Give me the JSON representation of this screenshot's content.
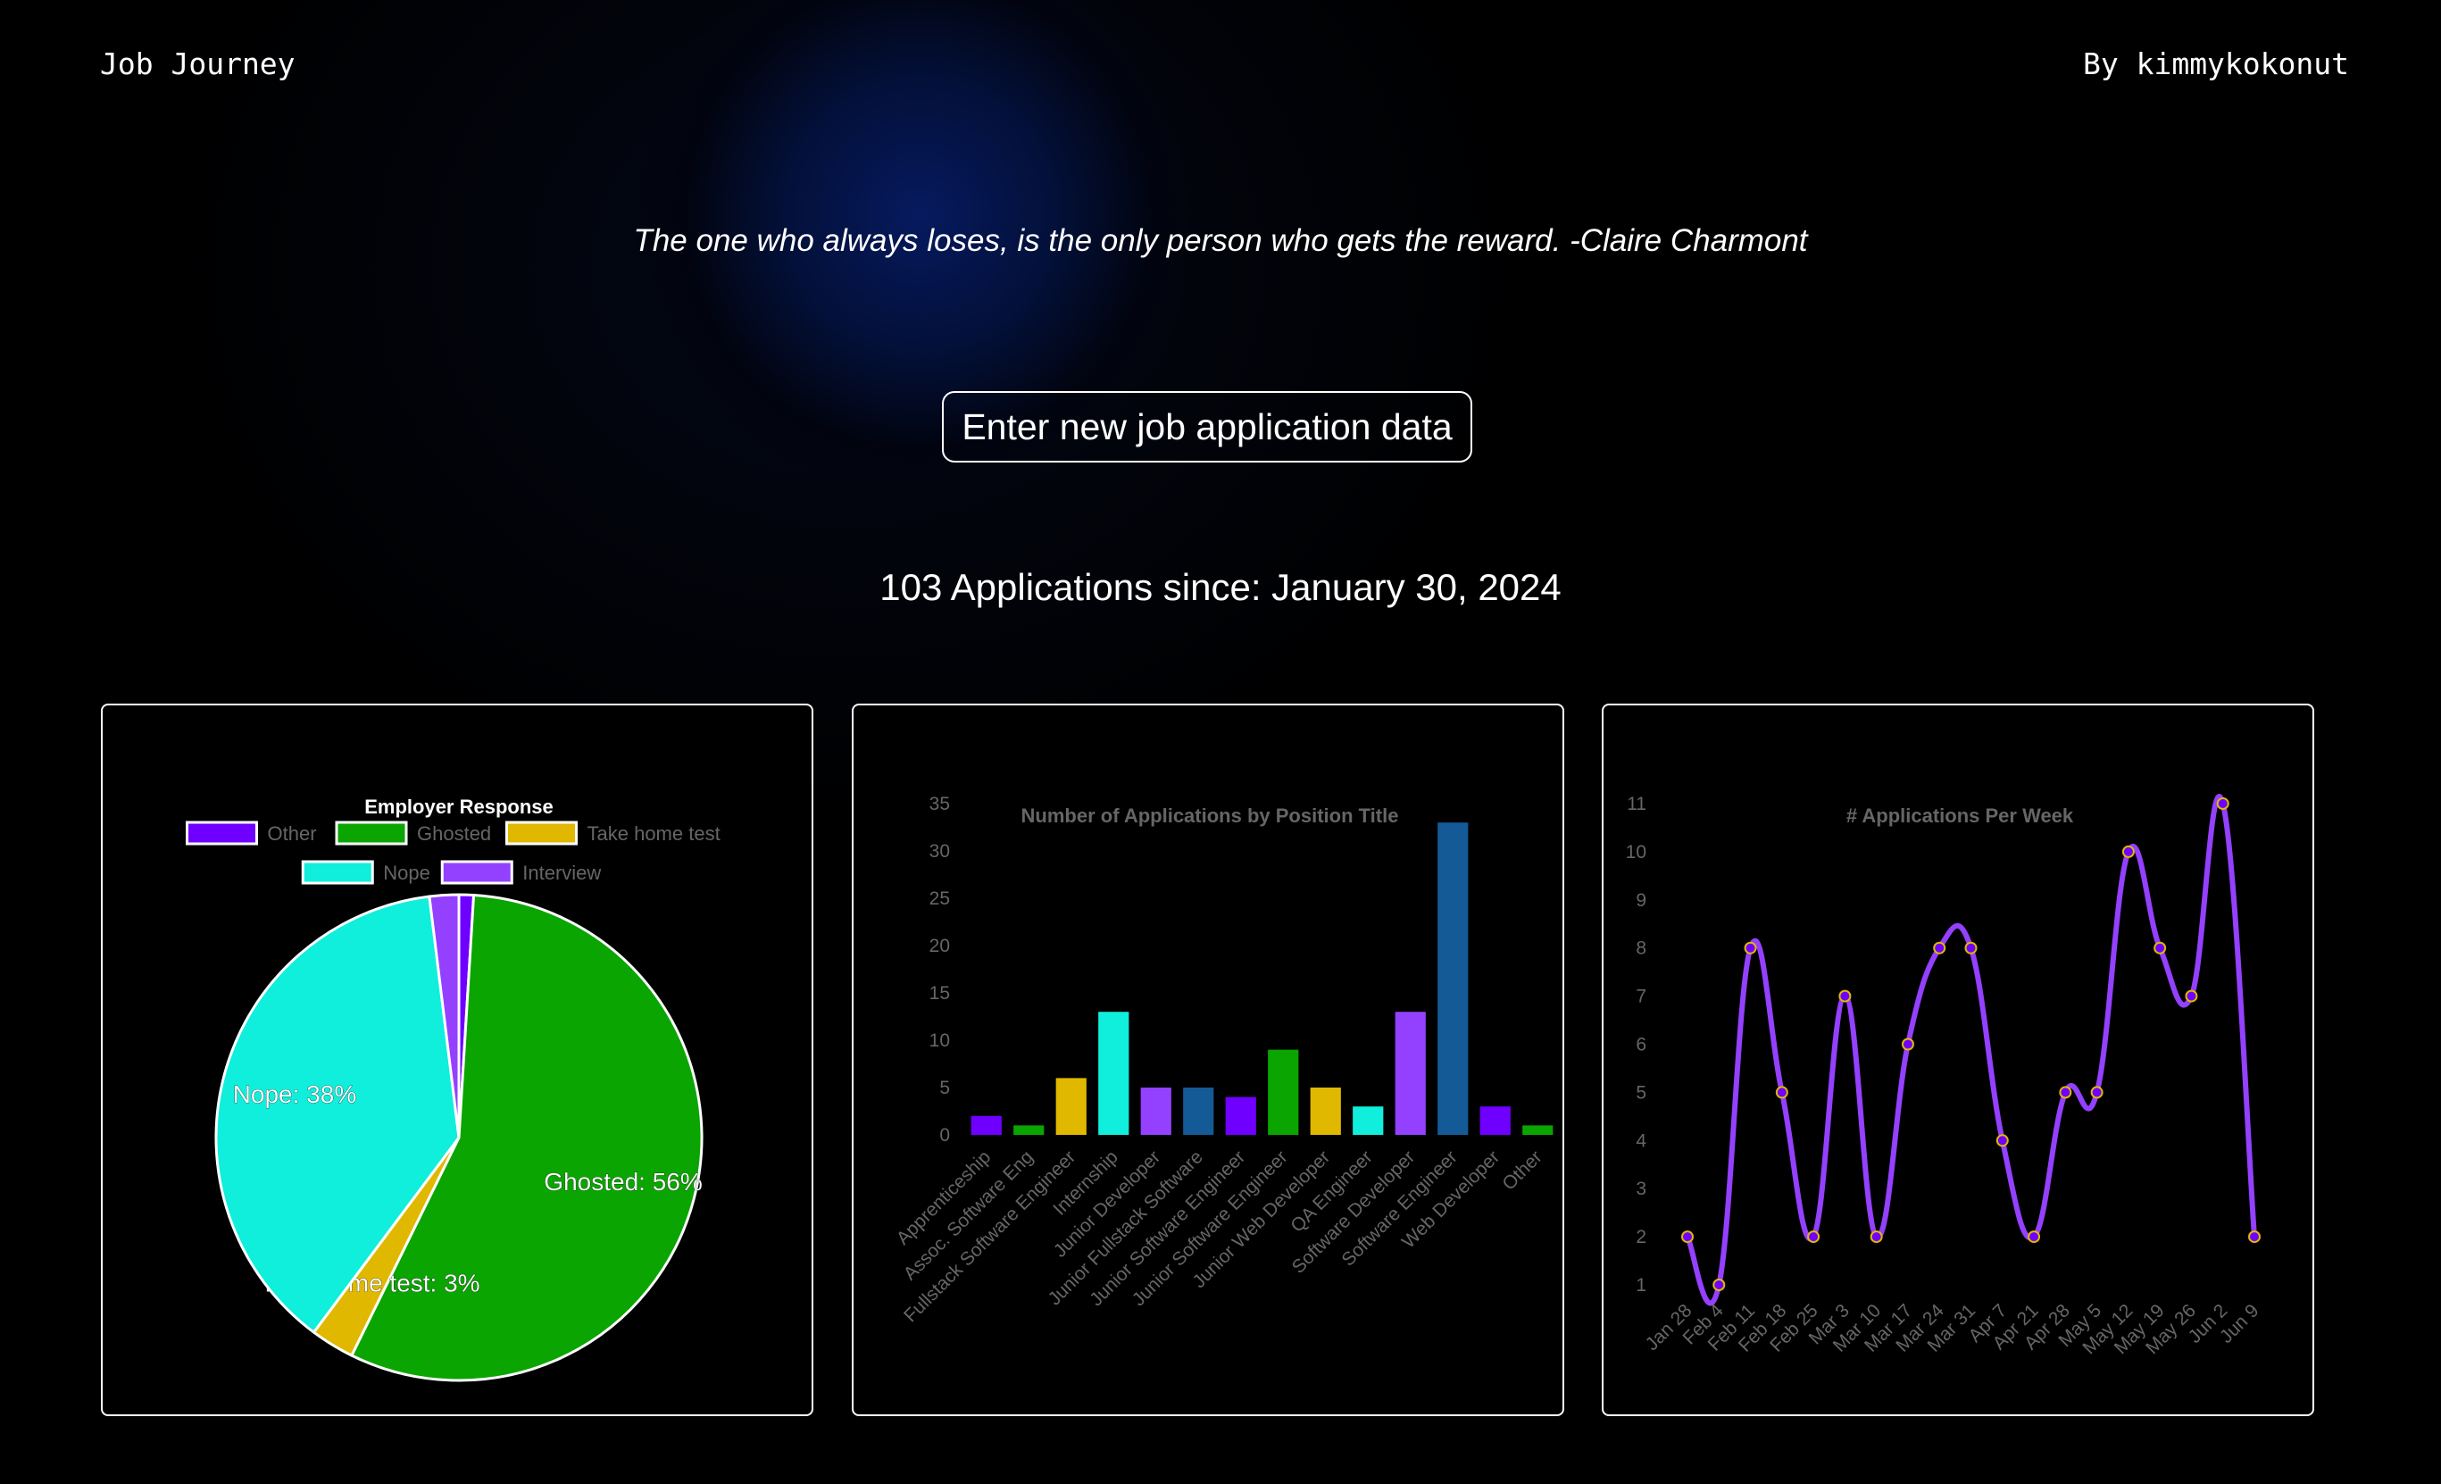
{
  "header": {
    "brand": "Job Journey",
    "author": "By kimmykokonut"
  },
  "quote": "The one who always loses, is the only person who gets the reward. -Claire Charmont",
  "cta_button": "Enter new job application data",
  "summary": "103 Applications since: January 30, 2024",
  "colors": {
    "other": "#6f00ff",
    "ghosted": "#0aa500",
    "take_home": "#e0b800",
    "nope": "#10eedc",
    "interview": "#9440ff",
    "blue": "#135a96",
    "line": "#9440ff",
    "point_border": "#e0b800"
  },
  "chart_data": [
    {
      "type": "pie",
      "title": "Employer Response",
      "legend_position": "top",
      "categories": [
        "Other",
        "Ghosted",
        "Take home test",
        "Nope",
        "Interview"
      ],
      "values": [
        1,
        58,
        3,
        39,
        2
      ],
      "colors": [
        "#6f00ff",
        "#0aa500",
        "#e0b800",
        "#10eedc",
        "#9440ff"
      ],
      "data_labels": [
        "",
        "Ghosted: 56%",
        "Take home test: 3%",
        "Nope: 38%",
        ""
      ]
    },
    {
      "type": "bar",
      "title": "Number of Applications by Position Title",
      "categories": [
        "Apprenticeship",
        "Assoc. Software Eng",
        "Fullstack Software Engineer",
        "Internship",
        "Junior Developer",
        "Junior Fullstack Software",
        "Junior Software Engineer",
        "Junior Software Engineer",
        "Junior Web Developer",
        "QA Engineer",
        "Software Developer",
        "Software Engineer",
        "Web Developer",
        "Other"
      ],
      "values": [
        2,
        1,
        6,
        13,
        5,
        5,
        4,
        9,
        5,
        3,
        13,
        33,
        3,
        1
      ],
      "colors": [
        "#6f00ff",
        "#0aa500",
        "#e0b800",
        "#10eedc",
        "#9440ff",
        "#135a96",
        "#6f00ff",
        "#0aa500",
        "#e0b800",
        "#10eedc",
        "#9440ff",
        "#135a96",
        "#6f00ff",
        "#0aa500"
      ],
      "ylim": [
        0,
        35
      ],
      "yticks": [
        0,
        5,
        10,
        15,
        20,
        25,
        30,
        35
      ],
      "xlabel": "",
      "ylabel": "",
      "grid": false
    },
    {
      "type": "line",
      "title": "# Applications Per Week",
      "x": [
        "Jan 28",
        "Feb 4",
        "Feb 11",
        "Feb 18",
        "Feb 25",
        "Mar 3",
        "Mar 10",
        "Mar 17",
        "Mar 24",
        "Mar 31",
        "Apr 7",
        "Apr 21",
        "Apr 28",
        "May 5",
        "May 12",
        "May 19",
        "May 26",
        "Jun 2",
        "Jun 9"
      ],
      "values": [
        2,
        1,
        8,
        5,
        2,
        7,
        2,
        6,
        8,
        8,
        4,
        2,
        5,
        5,
        10,
        8,
        7,
        11,
        2
      ],
      "ylim": [
        1,
        11
      ],
      "yticks": [
        1,
        2,
        3,
        4,
        5,
        6,
        7,
        8,
        9,
        10,
        11
      ],
      "smooth": true,
      "grid": false
    }
  ]
}
